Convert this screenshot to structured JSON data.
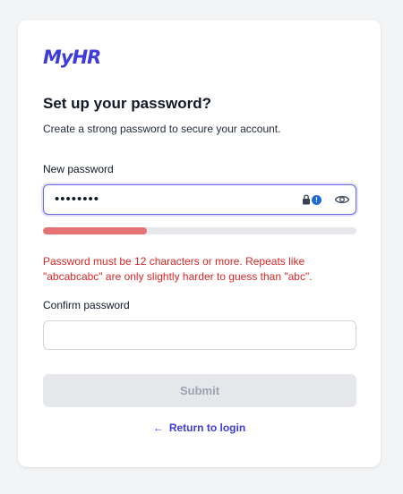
{
  "brand": {
    "logo_text": "MyHR",
    "color": "#3f3ad9"
  },
  "heading": {
    "title": "Set up your password?",
    "subtitle": "Create a strong password to secure your account."
  },
  "new_password": {
    "label": "New password",
    "value_masked": "••••••••",
    "strength_fraction": 0.33,
    "strength_color": "#e67373",
    "error": "Password must be 12 characters or more. Repeats like \"abcabcabc\" are only slightly harder to guess than \"abc\"."
  },
  "confirm_password": {
    "label": "Confirm password",
    "value": ""
  },
  "actions": {
    "submit_label": "Submit",
    "back_arrow": "←",
    "back_label": "Return to login"
  },
  "icons": {
    "password_manager": "password-manager-icon",
    "visibility": "eye-icon"
  }
}
